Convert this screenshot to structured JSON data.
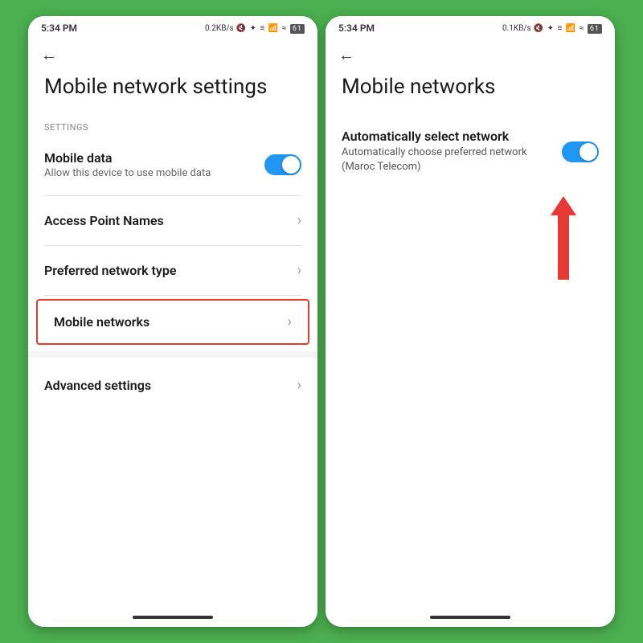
{
  "leftScreen": {
    "statusBar": {
      "time": "5:34 PM",
      "speed": "0.2KB/s",
      "icons": "🔇 ⊕ ☰ ⛔ .⊪ ≈ 61"
    },
    "backButton": "←",
    "title": "Mobile network settings",
    "sectionLabel": "SETTINGS",
    "items": [
      {
        "id": "mobile-data",
        "title": "Mobile data",
        "subtitle": "Allow this device to use mobile data",
        "type": "toggle",
        "toggleOn": true
      },
      {
        "id": "access-point-names",
        "title": "Access Point Names",
        "type": "chevron"
      },
      {
        "id": "preferred-network-type",
        "title": "Preferred network type",
        "type": "chevron"
      },
      {
        "id": "mobile-networks",
        "title": "Mobile networks",
        "type": "chevron",
        "highlighted": true
      },
      {
        "id": "advanced-settings",
        "title": "Advanced settings",
        "type": "chevron"
      }
    ]
  },
  "rightScreen": {
    "statusBar": {
      "time": "5:34 PM",
      "speed": "0.1KB/s",
      "icons": "🔇 ⊕ ☰ ⛔ .⊪ ≈ 61"
    },
    "backButton": "←",
    "title": "Mobile networks",
    "items": [
      {
        "id": "auto-select-network",
        "title": "Automatically select network",
        "subtitle": "Automatically choose preferred network (Maroc Telecom)",
        "type": "toggle",
        "toggleOn": true
      }
    ]
  },
  "icons": {
    "chevron": "›",
    "back": "←",
    "toggle_on_color": "#2196F3"
  }
}
